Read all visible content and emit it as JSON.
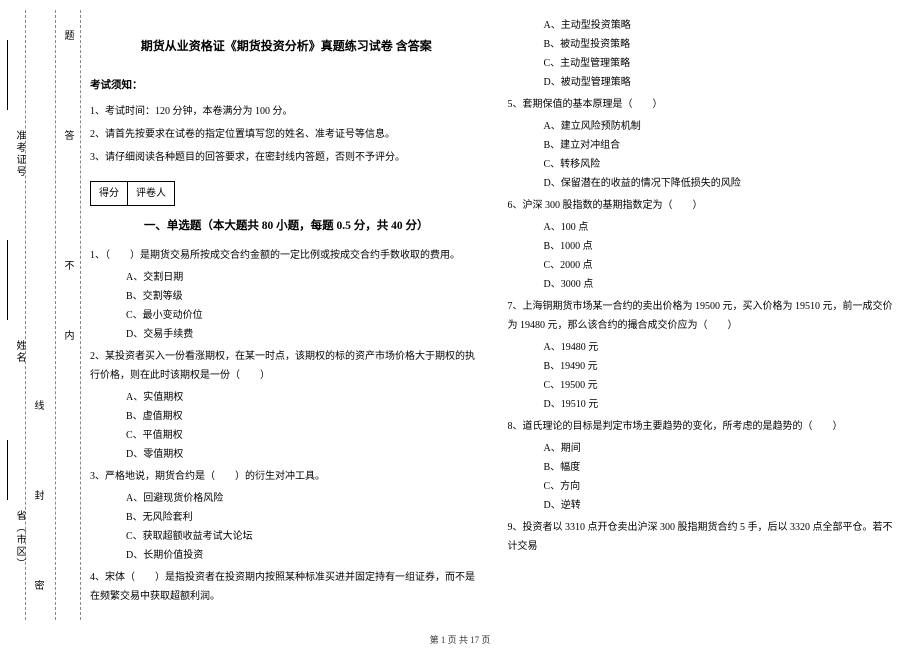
{
  "sidebar": {
    "labels": {
      "province": "省（市区）",
      "name": "姓名",
      "admission": "准考证号",
      "seal_marks": [
        "密",
        "封",
        "线",
        "内",
        "不",
        "答",
        "题"
      ]
    }
  },
  "doc": {
    "title": "期货从业资格证《期货投资分析》真题练习试卷 含答案",
    "notice_head": "考试须知：",
    "notices": [
      "1、考试时间：120 分钟，本卷满分为 100 分。",
      "2、请首先按要求在试卷的指定位置填写您的姓名、准考证号等信息。",
      "3、请仔细阅读各种题目的回答要求，在密封线内答题，否则不予评分。"
    ],
    "scorebox": {
      "left": "得分",
      "right": "评卷人"
    },
    "section1_title": "一、单选题（本大题共 80 小题，每题 0.5 分，共 40 分）",
    "left_items": [
      {
        "q": "1、（　　）是期货交易所按成交合约金额的一定比例或按成交合约手数收取的费用。",
        "opts": [
          "A、交割日期",
          "B、交割等级",
          "C、最小变动价位",
          "D、交易手续费"
        ]
      },
      {
        "q": "2、某投资者买入一份看涨期权，在某一时点，该期权的标的资产市场价格大于期权的执行价格，则在此时该期权是一份（　　）",
        "opts": [
          "A、实值期权",
          "B、虚值期权",
          "C、平值期权",
          "D、零值期权"
        ]
      },
      {
        "q": "3、严格地说，期货合约是（　　）的衍生对冲工具。",
        "opts": [
          "A、回避现货价格风险",
          "B、无风险套利",
          "C、获取超额收益考试大论坛",
          "D、长期价值投资"
        ]
      },
      {
        "q": "4、宋体（　　）是指投资者在投资期内按照某种标准买进并固定持有一组证券，而不是在频繁交易中获取超额利润。",
        "opts": []
      }
    ],
    "right_items": [
      {
        "q": "",
        "opts": [
          "A、主动型投资策略",
          "B、被动型投资策略",
          "C、主动型管理策略",
          "D、被动型管理策略"
        ]
      },
      {
        "q": "5、套期保值的基本原理是（　　）",
        "opts": [
          "A、建立风险预防机制",
          "B、建立对冲组合",
          "C、转移风险",
          "D、保留潜在的收益的情况下降低损失的风险"
        ]
      },
      {
        "q": "6、沪深 300 股指数的基期指数定为（　　）",
        "opts": [
          "A、100 点",
          "B、1000 点",
          "C、2000 点",
          "D、3000 点"
        ]
      },
      {
        "q": "7、上海铜期货市场某一合约的卖出价格为 19500 元，买入价格为 19510 元，前一成交价为 19480 元，那么该合约的撮合成交价应为（　　）",
        "opts": [
          "A、19480 元",
          "B、19490 元",
          "C、19500 元",
          "D、19510 元"
        ]
      },
      {
        "q": "8、道氏理论的目标是判定市场主要趋势的变化，所考虑的是趋势的（　　）",
        "opts": [
          "A、期间",
          "B、幅度",
          "C、方向",
          "D、逆转"
        ]
      },
      {
        "q": "9、投资者以 3310 点开仓卖出沪深 300 股指期货合约 5 手，后以 3320 点全部平仓。若不计交易",
        "opts": []
      }
    ],
    "footer": "第 1 页 共 17 页"
  }
}
